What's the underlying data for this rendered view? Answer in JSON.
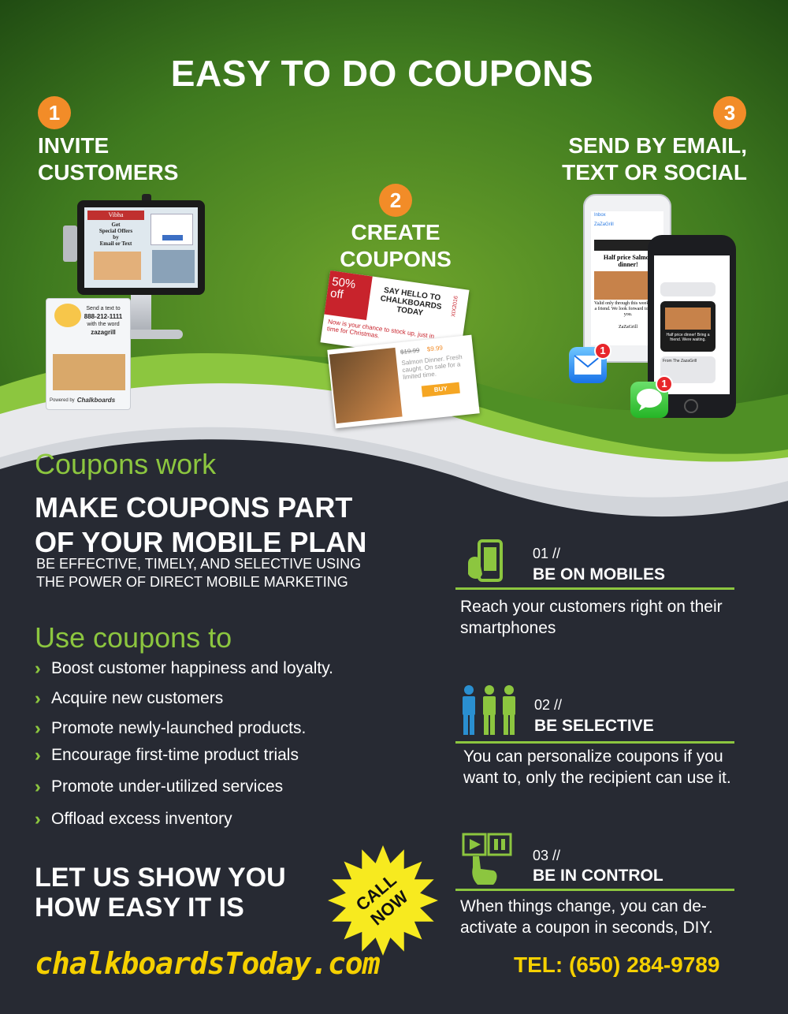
{
  "title": "EASY TO DO COUPONS",
  "steps": [
    {
      "number": "1",
      "label_line1": "INVITE",
      "label_line2": "CUSTOMERS"
    },
    {
      "number": "2",
      "label_line1": "CREATE",
      "label_line2": "COUPONS"
    },
    {
      "number": "3",
      "label_line1": "SEND BY EMAIL,",
      "label_line2": "TEXT OR SOCIAL"
    }
  ],
  "kiosk": {
    "screen_brand": "Vibha",
    "screen_line1": "Get",
    "screen_line2": "Special Offers",
    "screen_line3": "by",
    "screen_line4": "Email or Text",
    "tent_line1": "Send a text to",
    "tent_number": "888-212-1111",
    "tent_line2": "with the word",
    "tent_keyword": "zazagrill",
    "tent_footer": "Powered by",
    "tent_brand": "Chalkboards"
  },
  "coupon": {
    "discount": "50% off",
    "headline": "SAY HELLO TO CHALKBOARDS TODAY",
    "tagline": "Now is your chance to stock up, just in time for Christmas.",
    "old_price": "$19.99",
    "new_price": "$9.99",
    "desc": "Salmon Dinner. Fresh caught. On sale for a limited time.",
    "buy": "BUY",
    "code": "XIX2016"
  },
  "phones": {
    "email_inbox": "Inbox",
    "email_from": "ZaZaGrill",
    "email_headline": "Half price Salmon dinner!",
    "email_body": "Valid only through this week. Bring a friend. We look forward to seeing you.",
    "email_sign": "ZaZaGrill",
    "sms_body": "Half price dinner! Bring a friend. Were waiting.",
    "sms_from": "From The ZazaGrill",
    "badge": "1"
  },
  "left": {
    "coupons_work": "Coupons work",
    "headline_line1": "MAKE COUPONS PART",
    "headline_line2": "OF YOUR MOBILE PLAN",
    "sub_line1": "BE EFFECTIVE, TIMELY, AND SELECTIVE USING",
    "sub_line2": "THE POWER OF DIRECT MOBILE MARKETING",
    "use_title": "Use coupons to",
    "bullets": [
      "Boost customer happiness and loyalty.",
      "Acquire new customers",
      "Promote newly-launched products.",
      "Encourage first-time product trials",
      "Promote under-utilized services",
      "Offload excess inventory"
    ],
    "cta_line1": "LET US SHOW YOU",
    "cta_line2": "HOW EASY IT IS"
  },
  "call_now": {
    "line1": "CALL",
    "line2": "NOW"
  },
  "features": [
    {
      "num": "01 //",
      "title": "BE ON MOBILES",
      "desc_line1": "Reach your customers right on their",
      "desc_line2": "smartphones"
    },
    {
      "num": "02 //",
      "title": "BE SELECTIVE",
      "desc_line1": "You can personalize coupons if you",
      "desc_line2": "want to, only the recipient can use it."
    },
    {
      "num": "03 //",
      "title": "BE IN CONTROL",
      "desc_line1": "When things change, you can de-",
      "desc_line2": "activate a coupon in seconds, DIY."
    }
  ],
  "footer": {
    "website": "chalkboardsToday.com",
    "phone": "TEL: (650) 284-9789"
  },
  "colors": {
    "accent_green": "#8cc63f",
    "orange": "#f28c28",
    "dark_bg": "#272a33",
    "yellow": "#f5d000"
  }
}
